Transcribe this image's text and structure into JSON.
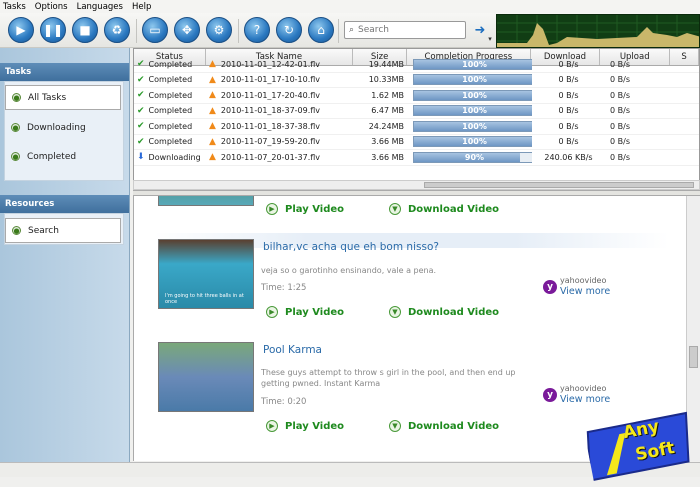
{
  "menu": [
    "Tasks",
    "Options",
    "Languages",
    "Help"
  ],
  "toolbar": {
    "search_placeholder": "Search"
  },
  "sidebar": {
    "tasks_header": "Tasks",
    "items": [
      "All Tasks",
      "Downloading",
      "Completed"
    ],
    "resources_header": "Resources",
    "resources_items": [
      "Search"
    ]
  },
  "table": {
    "columns": [
      "Status",
      "Task Name",
      "Size",
      "Completion Progress",
      "Download",
      "Upload",
      "S"
    ],
    "rows": [
      {
        "status": "Completed",
        "name": "2010-11-01_12-42-01.flv",
        "size": "19.44MB",
        "progress": 100,
        "progress_text": "100%",
        "download": "0 B/s",
        "upload": "0 B/s",
        "kind": "done"
      },
      {
        "status": "Completed",
        "name": "2010-11-01_17-10-10.flv",
        "size": "10.33MB",
        "progress": 100,
        "progress_text": "100%",
        "download": "0 B/s",
        "upload": "0 B/s",
        "kind": "done"
      },
      {
        "status": "Completed",
        "name": "2010-11-01_17-20-40.flv",
        "size": "1.62 MB",
        "progress": 100,
        "progress_text": "100%",
        "download": "0 B/s",
        "upload": "0 B/s",
        "kind": "done"
      },
      {
        "status": "Completed",
        "name": "2010-11-01_18-37-09.flv",
        "size": "6.47 MB",
        "progress": 100,
        "progress_text": "100%",
        "download": "0 B/s",
        "upload": "0 B/s",
        "kind": "done"
      },
      {
        "status": "Completed",
        "name": "2010-11-01_18-37-38.flv",
        "size": "24.24MB",
        "progress": 100,
        "progress_text": "100%",
        "download": "0 B/s",
        "upload": "0 B/s",
        "kind": "done"
      },
      {
        "status": "Completed",
        "name": "2010-11-07_19-59-20.flv",
        "size": "3.66 MB",
        "progress": 100,
        "progress_text": "100%",
        "download": "0 B/s",
        "upload": "0 B/s",
        "kind": "done"
      },
      {
        "status": "Downloading",
        "name": "2010-11-07_20-01-37.flv",
        "size": "3.66 MB",
        "progress": 90,
        "progress_text": "90%",
        "download": "240.06 KB/s",
        "upload": "0 B/s",
        "kind": "dl"
      }
    ]
  },
  "videos": [
    {
      "title": "bilhar,vc acha que eh bom nisso?",
      "desc": "veja so o garotinho ensinando, vale a pena.",
      "time": "Time: 1:25",
      "source": "yahoovideo",
      "more": "View more",
      "play": "Play Video",
      "download": "Download Video",
      "thumb_caption": "I'm going to hit three balls in at once"
    },
    {
      "title": "Pool Karma",
      "desc": "These guys attempt to throw s girl in the pool, and then end up getting pwned. Instant Karma",
      "time": "Time: 0:20",
      "source": "yahoovideo",
      "more": "View more",
      "play": "Play Video",
      "download": "Download Video"
    }
  ],
  "top_actions": {
    "play": "Play Video",
    "download": "Download Video"
  },
  "logo": {
    "line1": "Any",
    "line2": "Soft"
  },
  "colors": {
    "accent": "#2a6aa8",
    "green_action": "#1e8a1e",
    "sidebar_header": "#4a7aa8"
  }
}
